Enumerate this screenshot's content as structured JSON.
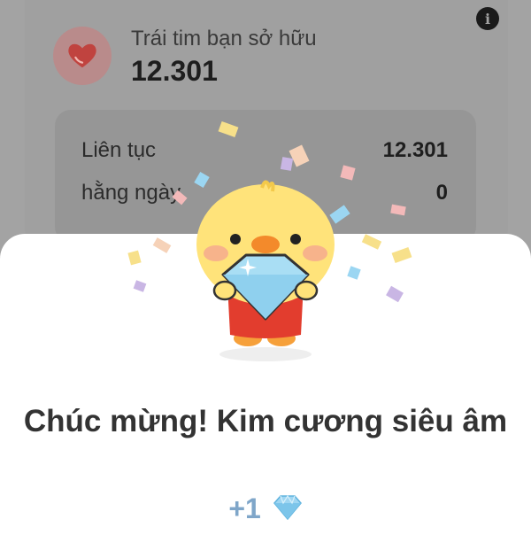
{
  "header": {
    "owned_label": "Trái tim bạn sở hữu",
    "owned_value": "12.301",
    "info_icon": "i"
  },
  "stats": [
    {
      "label": "Liên tục",
      "value": "12.301"
    },
    {
      "label": "hằng ngày",
      "value": "0"
    }
  ],
  "dialog": {
    "title": "Chúc mừng! Kim cương siêu âm",
    "reward": "+1",
    "reward_icon": "diamond-icon"
  },
  "colors": {
    "heart": "#d94a4a",
    "reward": "#7fa6c9",
    "diamond": "#8fd0ee",
    "chick_body": "#ffe37a",
    "chick_shirt": "#e23d2e"
  }
}
